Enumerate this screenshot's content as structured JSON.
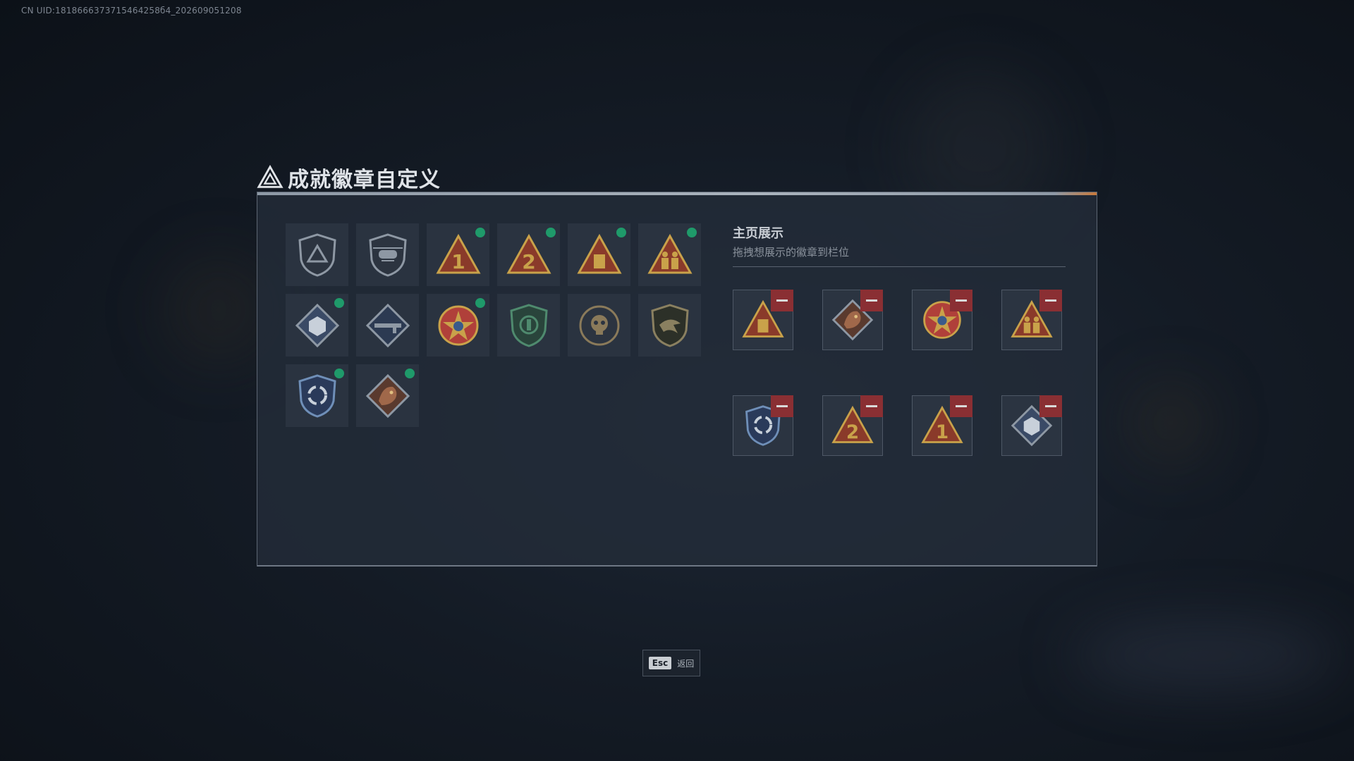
{
  "uid_text": "CN UID:1818666373715464258б4_202609051208",
  "title": "成就徽章自定义",
  "colors": {
    "accent_orange": "#c8793b",
    "new_dot": "#1f9a6a",
    "remove": "#8a2f33",
    "gold": "#c9a24a"
  },
  "badges": [
    {
      "icon": "triangle-shield-badge-icon",
      "new": false
    },
    {
      "icon": "helicopter-badge-icon",
      "new": false
    },
    {
      "icon": "number-1-triangle-badge-icon",
      "new": true
    },
    {
      "icon": "number-2-triangle-badge-icon",
      "new": true
    },
    {
      "icon": "supply-crate-triangle-badge-icon",
      "new": true
    },
    {
      "icon": "soldiers-triangle-badge-icon",
      "new": true
    },
    {
      "icon": "diamond-cube-badge-icon",
      "new": true
    },
    {
      "icon": "diamond-rifle-badge-icon",
      "new": false
    },
    {
      "icon": "star-emblem-badge-icon",
      "new": true
    },
    {
      "icon": "green-shield-badge-icon",
      "new": false
    },
    {
      "icon": "skull-emblem-badge-icon",
      "new": false
    },
    {
      "icon": "eagle-shield-badge-icon",
      "new": false
    },
    {
      "icon": "recycle-shield-badge-icon",
      "new": true
    },
    {
      "icon": "dragon-diamond-badge-icon",
      "new": true
    }
  ],
  "showcase": {
    "title": "主页展示",
    "subtitle": "拖拽想展示的徽章到栏位",
    "slots": [
      {
        "icon": "supply-crate-triangle-badge-icon"
      },
      {
        "icon": "dragon-diamond-badge-icon"
      },
      {
        "icon": "star-emblem-badge-icon"
      },
      {
        "icon": "soldiers-triangle-badge-icon"
      },
      {
        "icon": "recycle-shield-badge-icon"
      },
      {
        "icon": "number-2-triangle-badge-icon"
      },
      {
        "icon": "number-1-triangle-badge-icon"
      },
      {
        "icon": "diamond-cube-badge-icon"
      }
    ]
  },
  "footer": {
    "key": "Esc",
    "label": "返回"
  }
}
